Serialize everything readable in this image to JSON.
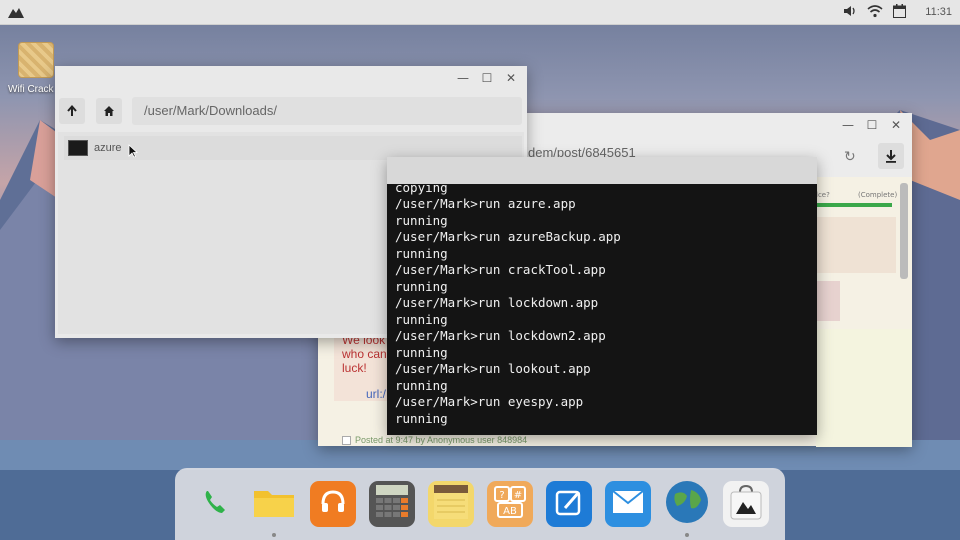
{
  "topbar": {
    "left_icon": "mountain-icon",
    "status_icons": [
      "volume-icon",
      "wifi-icon",
      "calendar-icon"
    ],
    "clock": "11:31"
  },
  "desktop_icons": [
    {
      "label": "Wifi Crack",
      "icon": "cracker-icon"
    }
  ],
  "file_manager": {
    "path": "/user/Mark/Downloads/",
    "items": [
      {
        "name": "azure",
        "icon": "terminal-icon"
      }
    ]
  },
  "browser": {
    "url": "dem/post/6845651",
    "stat_left": "lce?",
    "stat_right": "(Complete)",
    "post_message": "We look who can luck!",
    "post_link": "url:/",
    "posted_by": "Posted at 9:47 by Anonymous user 848984"
  },
  "terminal": {
    "lines": [
      "copying",
      "/user/Mark>run azure.app",
      "running",
      "/user/Mark>run azureBackup.app",
      "running",
      "/user/Mark>run crackTool.app",
      "running",
      "/user/Mark>run lockdown.app",
      "running",
      "/user/Mark>run lockdown2.app",
      "running",
      "/user/Mark>run lookout.app",
      "running",
      "/user/Mark>run eyespy.app",
      "running"
    ]
  },
  "dock": {
    "items": [
      {
        "name": "phone",
        "icon": "phone-icon",
        "color": "#2fb24a",
        "running": false
      },
      {
        "name": "files",
        "icon": "folder-icon",
        "color": "#f2c12e",
        "running": true
      },
      {
        "name": "music",
        "icon": "headphones-icon",
        "color": "#f07c22",
        "running": false
      },
      {
        "name": "calculator",
        "icon": "calculator-icon",
        "color": "#555555",
        "running": false
      },
      {
        "name": "notes",
        "icon": "notepad-icon",
        "color": "#f3d76b",
        "running": false
      },
      {
        "name": "text-tools",
        "icon": "keyboard-icon",
        "color": "#f0a95a",
        "running": false
      },
      {
        "name": "editor",
        "icon": "pen-tablet-icon",
        "color": "#1e7bd6",
        "running": false
      },
      {
        "name": "mail",
        "icon": "mail-icon",
        "color": "#2d8fe0",
        "running": false
      },
      {
        "name": "browser",
        "icon": "globe-icon",
        "color": "#2a78b8",
        "running": true
      },
      {
        "name": "store",
        "icon": "bag-icon",
        "color": "#f2f2f2",
        "running": false
      }
    ]
  }
}
